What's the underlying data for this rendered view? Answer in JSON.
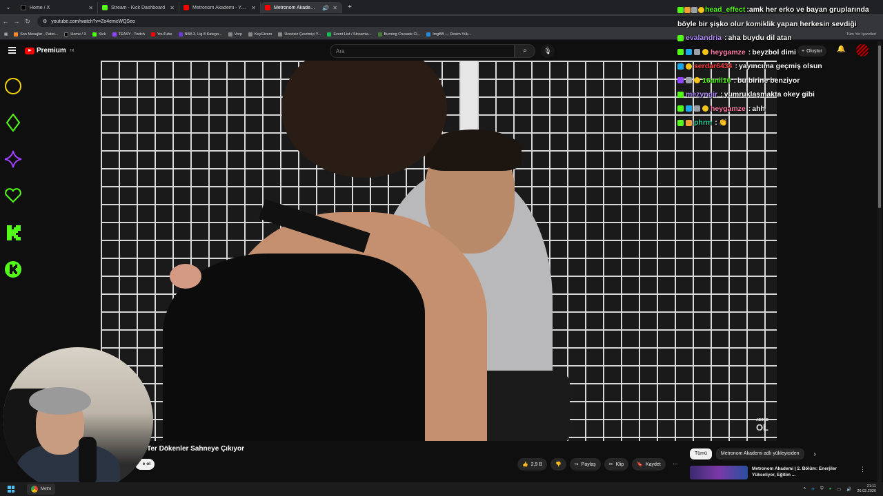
{
  "browser": {
    "tabs": [
      {
        "label": "Home / X",
        "color": "#000000",
        "active": false
      },
      {
        "label": "Stream - Kick Dashboard",
        "color": "#53fc18",
        "active": false
      },
      {
        "label": "Metronom Akademi - YouTube",
        "color": "#ff0000",
        "active": false
      },
      {
        "label": "Metronom Akademi | 1. Bö",
        "color": "#ff0000",
        "active": true
      }
    ],
    "url": "youtube.com/watch?v=Zo4emcWQSeo",
    "bookmarks": [
      "Son Mesajlar - Patici...",
      "Home / X",
      "Kick",
      "TEASY - Twitch",
      "YouTube",
      "NBA 3. Lig 8 Katego...",
      "Vorp",
      "KeyGivers",
      "Ücretsiz Çevrimiçi Y...",
      "Event List / Streamla...",
      "Burning Crusade Cl...",
      "ImgBB — Resim Yük..."
    ],
    "bookmarks_right": "Tüm Yer İşaretleri"
  },
  "youtube": {
    "brand": "Premium",
    "region": "TR",
    "search_placeholder": "Ara",
    "create_label": "Oluştur",
    "video_title": "Ter Dökenler Sahneye Çıkıyor",
    "subscribe_label": "e ol",
    "actions": {
      "likes": "2,9 B",
      "share": "Paylaş",
      "clip": "Klip",
      "save": "Kaydet"
    },
    "chips": [
      "Tümü",
      "Metronom Akademi adlı yükleyiciden"
    ],
    "recommendation": "Metronom Akademi | 2. Bölüm: Enerjiler Yükseliyor, Eğitim ...",
    "watermark_small": "ABONE",
    "watermark_big": "OL"
  },
  "chat": [
    {
      "user": "head_effect",
      "color": "#53fc18",
      "badges": [
        "b-kick",
        "b-sub",
        "b-rocket",
        "b-coin"
      ],
      "text": "amk her erko ve bayan gruplarında böyle bir şişko olur komiklik yapan herkesin sevdiği"
    },
    {
      "user": "evalandria",
      "color": "#b38cff",
      "badges": [
        "b-kick"
      ],
      "text": "aha buydu dil atan"
    },
    {
      "user": "heygamze",
      "color": "#ff7aa8",
      "badges": [
        "b-kick",
        "b-blue",
        "b-rocket",
        "b-coin"
      ],
      "text": "beyzbol dimi"
    },
    {
      "user": "serdar6434",
      "color": "#ff4040",
      "badges": [
        "b-blue",
        "b-coin"
      ],
      "text": "yayıncıma geçmiş olsun"
    },
    {
      "user": "16anil16",
      "color": "#53fc18",
      "badges": [
        "b-purple",
        "b-rocket",
        "b-coin"
      ],
      "text": "bu birine benziyor"
    },
    {
      "user": "mezyngir",
      "color": "#b38cff",
      "badges": [
        "b-kick"
      ],
      "text": "yumruklaşmakta okey gibi"
    },
    {
      "user": "heygamze",
      "color": "#ff7aa8",
      "badges": [
        "b-kick",
        "b-blue",
        "b-rocket",
        "b-coin"
      ],
      "text": "ahh"
    },
    {
      "user": "phrm",
      "color": "#2ecc9a",
      "badges": [
        "b-kick",
        "b-sub"
      ],
      "text": "👏"
    }
  ],
  "taskbar": {
    "app_label": "Metro",
    "time": "21:11",
    "date": "26.02.2026"
  }
}
